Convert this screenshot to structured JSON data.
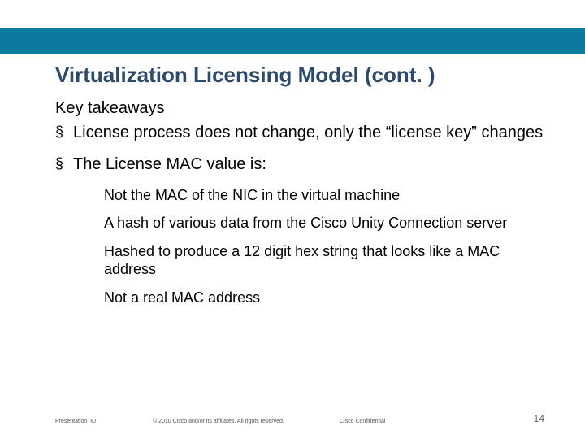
{
  "title": "Virtualization Licensing Model (cont. )",
  "subhead": "Key takeaways",
  "bullets": {
    "b1": "License process does not change, only the “license key” changes",
    "b2": "The License MAC value is:"
  },
  "sub": {
    "s1": "Not the MAC of the NIC in the virtual machine",
    "s2": "A hash of various data from the Cisco Unity Connection server",
    "s3": "Hashed to produce a 12 digit hex string that looks like a MAC address",
    "s4": "Not a real MAC address"
  },
  "footer": {
    "id": "Presentation_ID",
    "copyright": "© 2010 Cisco and/or its affiliates. All rights reserved.",
    "confidential": "Cisco Confidential",
    "page": "14"
  }
}
